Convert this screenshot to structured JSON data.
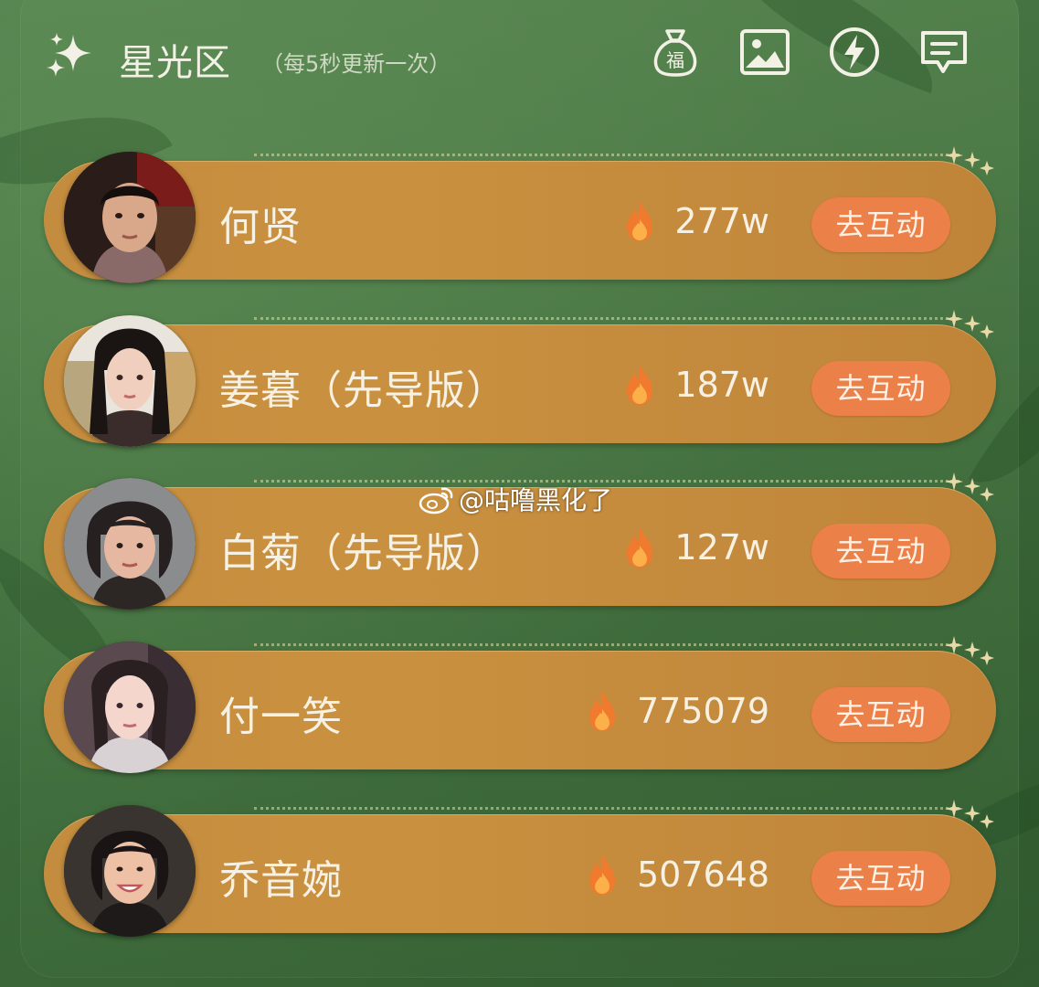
{
  "header": {
    "title": "星光区",
    "subtitle": "（每5秒更新一次）",
    "icons": [
      "sparkle-icon",
      "fortune-bag-icon",
      "image-icon",
      "lightning-icon",
      "message-icon"
    ],
    "fortune_bag_char": "福"
  },
  "cards": [
    {
      "name": "何贤",
      "heat": "277w",
      "button": "去互动"
    },
    {
      "name": "姜暮（先导版）",
      "heat": "187w",
      "button": "去互动"
    },
    {
      "name": "白菊（先导版）",
      "heat": "127w",
      "button": "去互动"
    },
    {
      "name": "付一笑",
      "heat": "775079",
      "button": "去互动"
    },
    {
      "name": "乔音婉",
      "heat": "507648",
      "button": "去互动"
    }
  ],
  "watermark": "@咕噜黑化了",
  "colors": {
    "background": "#3f6b3d",
    "card": "#c48c3e",
    "button": "#ec8049",
    "text": "#f7f1e4"
  }
}
